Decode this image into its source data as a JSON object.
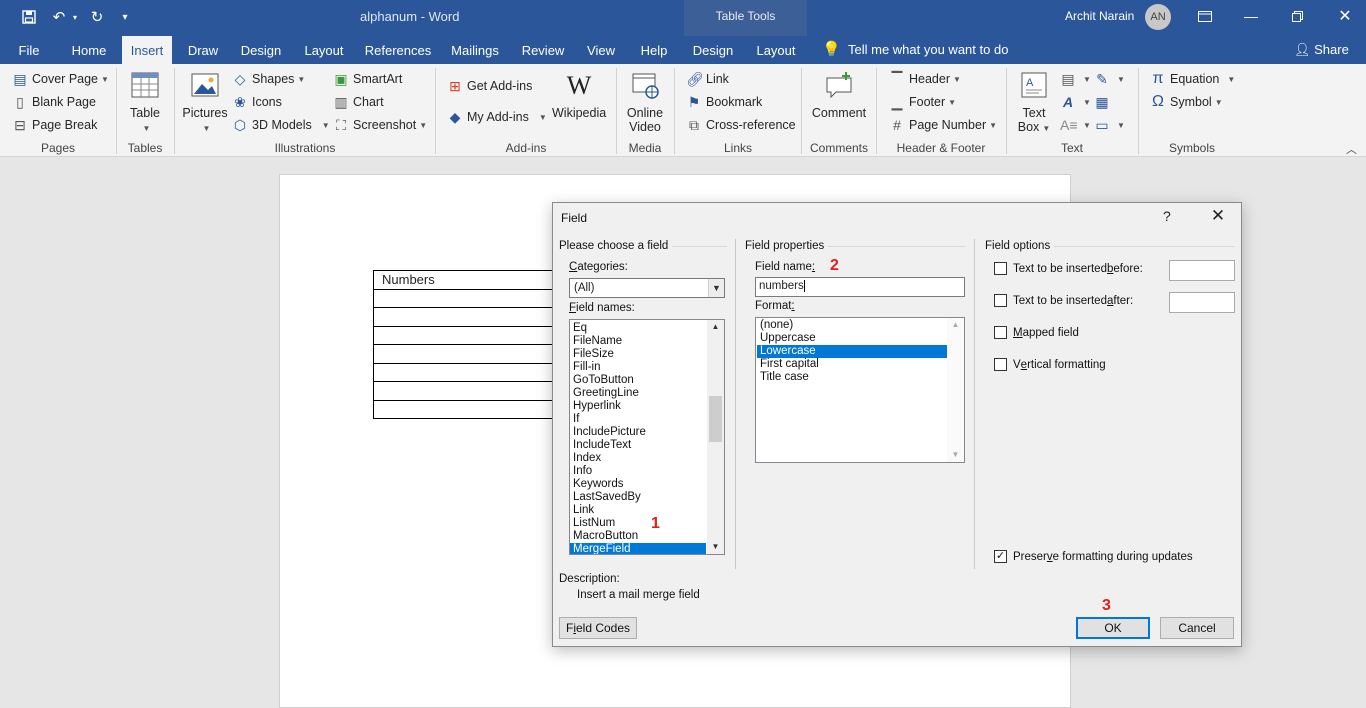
{
  "title_bar": {
    "document_title": "alphanum  -  Word",
    "context_tab_group": "Table Tools",
    "user_name": "Archit Narain",
    "user_initials": "AN",
    "icons": [
      "save-icon",
      "undo-icon",
      "redo-icon",
      "customize-qat-icon",
      "ribbon-display-icon",
      "minimize-icon",
      "restore-icon",
      "close-icon"
    ]
  },
  "tabs": [
    "File",
    "Home",
    "Insert",
    "Draw",
    "Design",
    "Layout",
    "References",
    "Mailings",
    "Review",
    "View",
    "Help",
    "Design",
    "Layout"
  ],
  "active_tab": "Insert",
  "tell_me": "Tell me what you want to do",
  "share": "Share",
  "ribbon": {
    "pages": {
      "label": "Pages",
      "cover_page": "Cover Page",
      "blank_page": "Blank Page",
      "page_break": "Page Break"
    },
    "tables": {
      "label": "Tables",
      "table": "Table"
    },
    "illustrations": {
      "label": "Illustrations",
      "pictures": "Pictures",
      "shapes": "Shapes",
      "icons": "Icons",
      "models": "3D Models",
      "smartart": "SmartArt",
      "chart": "Chart",
      "screenshot": "Screenshot"
    },
    "addins": {
      "label": "Add-ins",
      "get": "Get Add-ins",
      "my": "My Add-ins",
      "wikipedia": "Wikipedia"
    },
    "media": {
      "label": "Media",
      "online_video_1": "Online",
      "online_video_2": "Video"
    },
    "links": {
      "label": "Links",
      "link": "Link",
      "bookmark": "Bookmark",
      "crossref": "Cross-reference"
    },
    "comments": {
      "label": "Comments",
      "comment": "Comment"
    },
    "header_footer": {
      "label": "Header & Footer",
      "header": "Header",
      "footer": "Footer",
      "page_number": "Page Number"
    },
    "text": {
      "label": "Text",
      "text_box_1": "Text",
      "text_box_2": "Box"
    },
    "symbols": {
      "label": "Symbols",
      "equation": "Equation",
      "symbol": "Symbol"
    }
  },
  "document": {
    "table_header": "Numbers",
    "empty_rows": 7
  },
  "dialog": {
    "title": "Field",
    "help": "?",
    "choose_section": "Please choose a field",
    "categories_label_pre": "",
    "categories_label_u": "C",
    "categories_label_post": "ategories:",
    "categories_value": "(All)",
    "field_names_label_pre": "",
    "field_names_label_u": "F",
    "field_names_label_post": "ield names:",
    "field_names": [
      "Eq",
      "FileName",
      "FileSize",
      "Fill-in",
      "GoToButton",
      "GreetingLine",
      "Hyperlink",
      "If",
      "IncludePicture",
      "IncludeText",
      "Index",
      "Info",
      "Keywords",
      "LastSavedBy",
      "Link",
      "ListNum",
      "MacroButton",
      "MergeField"
    ],
    "selected_field": "MergeField",
    "properties_section": "Field properties",
    "field_name_label_pre": "Field name",
    "field_name_label_u": ":",
    "field_name_value": "numbers",
    "format_label_pre": "Format",
    "format_label_u": ":",
    "formats": [
      "(none)",
      "Uppercase",
      "Lowercase",
      "First capital",
      "Title case"
    ],
    "selected_format": "Lowercase",
    "options_section": "Field options",
    "opt_before_pre": "Text to be inserted ",
    "opt_before_u": "b",
    "opt_before_post": "efore:",
    "opt_after_pre": "Text to be inserted ",
    "opt_after_u": "a",
    "opt_after_post": "fter:",
    "opt_mapped_u": "M",
    "opt_mapped_post": "apped field",
    "opt_vertical_pre": "V",
    "opt_vertical_u": "e",
    "opt_vertical_post": "rtical formatting",
    "opt_preserve_pre": "Preser",
    "opt_preserve_u": "v",
    "opt_preserve_post": "e formatting during updates",
    "description_label": "Description:",
    "description_text": "Insert a mail merge field",
    "field_codes_pre": "F",
    "field_codes_u": "i",
    "field_codes_post": "eld Codes",
    "ok": "OK",
    "cancel": "Cancel"
  },
  "annotations": [
    "1",
    "2",
    "3"
  ],
  "colors": {
    "word_blue": "#2b579a",
    "selection": "#0078d7",
    "annotation_red": "#e0201a"
  }
}
